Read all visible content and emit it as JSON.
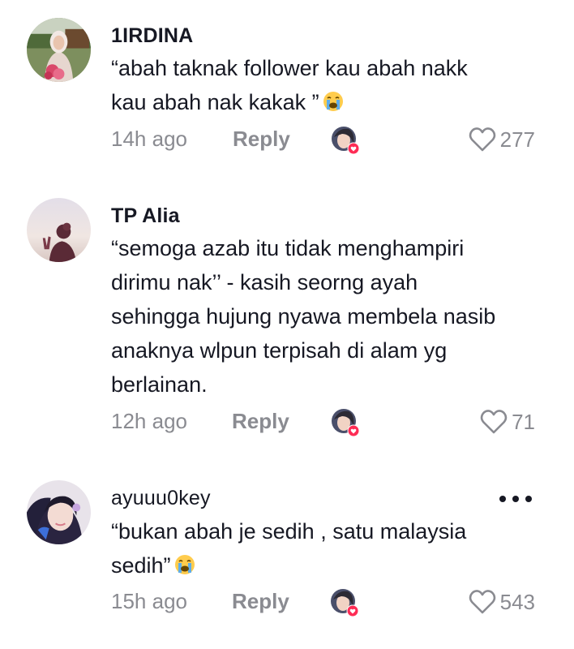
{
  "comments": [
    {
      "username": "1IRDINA",
      "text": "“abah taknak follower kau abah nakk\nkau abah nak kakak ”",
      "emoji": "loudly-crying-face",
      "time": "14h ago",
      "reply_label": "Reply",
      "likes": "277"
    },
    {
      "username": "TP Alia",
      "text": "“semoga azab itu tidak menghampiri\ndirimu nak’’ - kasih seorng ayah\nsehingga hujung nyawa membela nasib\nanaknya wlpun terpisah di alam yg\nberlainan.",
      "emoji": "",
      "time": "12h ago",
      "reply_label": "Reply",
      "likes": "71"
    },
    {
      "username": "ayuuu0key",
      "text": "“bukan abah je sedih , satu malaysia\nsedih”",
      "emoji": "loudly-crying-face",
      "time": "15h ago",
      "reply_label": "Reply",
      "likes": "543"
    }
  ],
  "colors": {
    "text_primary": "#161823",
    "text_secondary": "#8a8b91",
    "creator_heart": "#fe2c55"
  }
}
